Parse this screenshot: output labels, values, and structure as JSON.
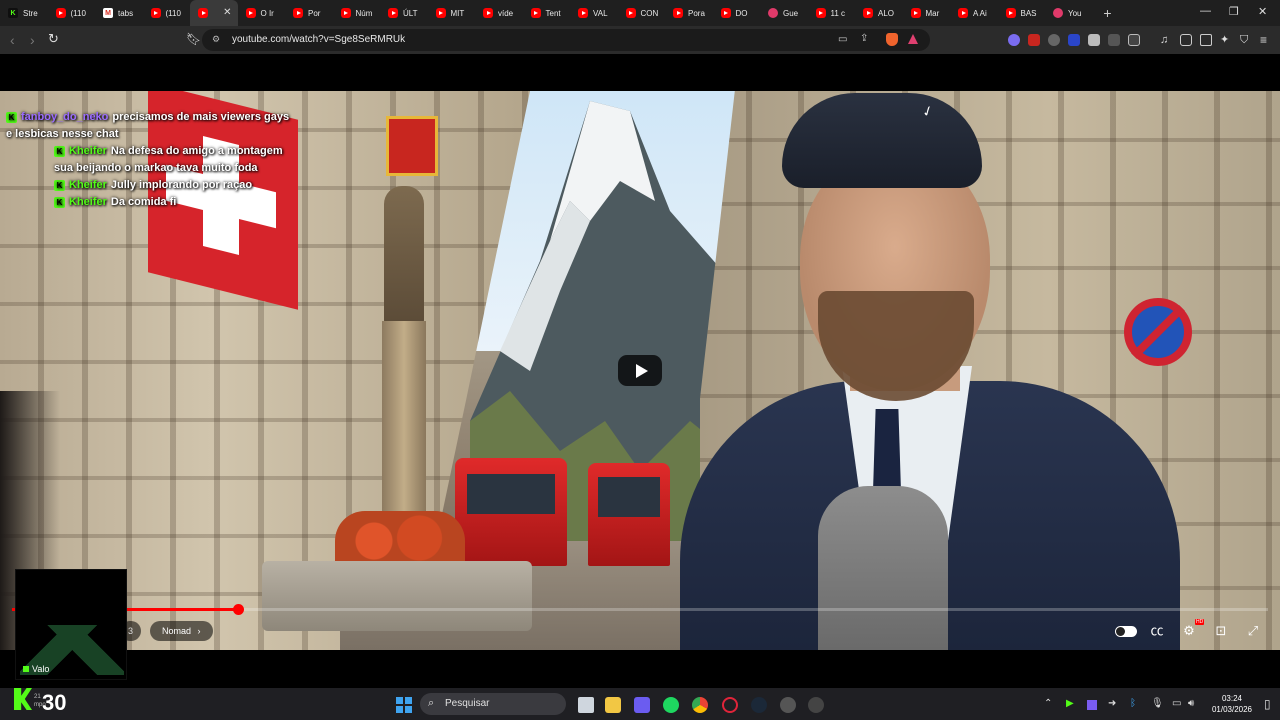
{
  "browser": {
    "tabs": [
      {
        "label": "Stre",
        "favicon": "kick-icon"
      },
      {
        "label": "(110",
        "favicon": "youtube-icon"
      },
      {
        "label": "tabs",
        "favicon": "gmail-icon"
      },
      {
        "label": "(110",
        "favicon": "youtube-icon"
      },
      {
        "label": "",
        "favicon": "youtube-icon",
        "active": true
      },
      {
        "label": "O Ir",
        "favicon": "youtube-icon"
      },
      {
        "label": "Por",
        "favicon": "youtube-icon"
      },
      {
        "label": "Núm",
        "favicon": "youtube-icon"
      },
      {
        "label": "ÚLT",
        "favicon": "youtube-icon"
      },
      {
        "label": "MIT",
        "favicon": "youtube-icon"
      },
      {
        "label": "víde",
        "favicon": "youtube-icon"
      },
      {
        "label": "Tent",
        "favicon": "youtube-icon"
      },
      {
        "label": "VAL",
        "favicon": "youtube-icon"
      },
      {
        "label": "CON",
        "favicon": "youtube-icon"
      },
      {
        "label": "Pora",
        "favicon": "youtube-icon"
      },
      {
        "label": "DO",
        "favicon": "youtube-icon"
      },
      {
        "label": "Gue",
        "favicon": "circle-icon"
      },
      {
        "label": "11 c",
        "favicon": "youtube-icon"
      },
      {
        "label": "ALO",
        "favicon": "youtube-icon"
      },
      {
        "label": "Mar",
        "favicon": "youtube-icon"
      },
      {
        "label": "A Ai",
        "favicon": "youtube-icon"
      },
      {
        "label": "BAS",
        "favicon": "youtube-icon"
      },
      {
        "label": "You",
        "favicon": "circle-icon"
      }
    ],
    "new_tab": "+",
    "url": "youtube.com/watch?v=Sge8SeRMRUk"
  },
  "chat": [
    {
      "user": "fanboy_do_neko",
      "message": "precisamos de mais viewers gays e lesbicas nesse chat",
      "color": "#9b6cff"
    },
    {
      "user": "Kheifer",
      "message": "Na defesa do amigo a montagem sua beijando o markao tava muito foda",
      "color": "#53fc18"
    },
    {
      "user": "Kheifer",
      "message": "Jully implorando por raçao",
      "color": "#53fc18"
    },
    {
      "user": "Kheifer",
      "message": "Da comida fi",
      "color": "#53fc18"
    }
  ],
  "player": {
    "progress_fraction": 0.18,
    "time_text": "3",
    "chapter": "Nomad",
    "chapter_arrow": "›"
  },
  "overlay": {
    "cam_label": "Valo",
    "kick_number": "30",
    "kick_small": "21\nmpo"
  },
  "taskbar": {
    "search_placeholder": "Pesquisar",
    "time": "03:24",
    "date": "01/03/2026"
  },
  "colors": {
    "kick_green": "#53fc18",
    "youtube_red": "#ff0000",
    "chat_purple": "#9b6cff"
  }
}
